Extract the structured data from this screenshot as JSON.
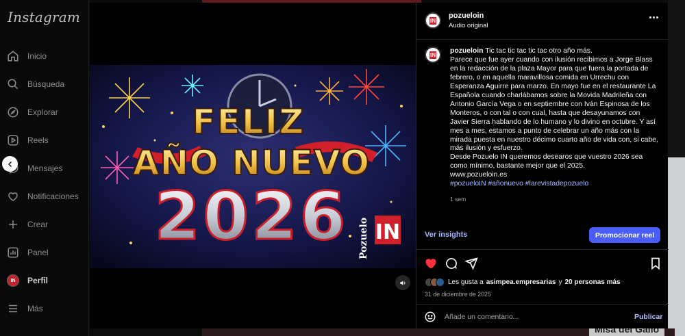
{
  "app": {
    "logo_text": "Instagram"
  },
  "sidebar": {
    "items": [
      {
        "label": "Inicio",
        "icon": "home-icon"
      },
      {
        "label": "Búsqueda",
        "icon": "search-icon"
      },
      {
        "label": "Explorar",
        "icon": "compass-icon"
      },
      {
        "label": "Reels",
        "icon": "reels-icon"
      },
      {
        "label": "Mensajes",
        "icon": "messenger-icon"
      },
      {
        "label": "Notificaciones",
        "icon": "heart-icon"
      },
      {
        "label": "Crear",
        "icon": "plus-icon"
      },
      {
        "label": "Panel",
        "icon": "dashboard-icon"
      },
      {
        "label": "Perfil",
        "icon": "avatar"
      },
      {
        "label": "Más",
        "icon": "menu-icon"
      }
    ]
  },
  "post": {
    "username": "pozueloin",
    "audio": "Audio original",
    "avatar_text": "IN",
    "image": {
      "line1": "FELIZ",
      "line2": "AÑO NUEVO",
      "line3": "2026",
      "brand_vertical": "Pozuelo",
      "brand_badge": "IN"
    },
    "caption": {
      "username": "pozueloin",
      "lines": [
        "Tic tac tic tac tic tac otro año más.",
        "Parece que fue ayer cuando con ilusión recibimos a Jorge Blass en la redacción de la plaza Mayor para que fuera la portada de febrero, o en aquella maravillosa comida en Urrechu con Esperanza Aguirre para marzo. En mayo fue en el restaurante La Española cuando charlábamos sobre la Movida Madrileña con Antonio García Vega o en septiembre con Iván Espinosa de los Monteros, o con tal o con cual, hasta que desayunamos con Javier Sierra hablando de lo humano y lo divino en octubre. Y así mes a mes, estamos a punto de celebrar un año más con la mirada puesta en nuestro décimo cuarto año de vida con, si cabe, más ilusión y esfuerzo.",
        "Desde Pozuelo IN queremos desearos que vuestro 2026 sea como mínimo, bastante mejor que el 2025.",
        "www.pozueloin.es"
      ],
      "hashtags": "#pozueloIN #añonuevo #larevistadepozuelo",
      "time_ago": "1 sem"
    },
    "insights_label": "Ver insights",
    "promote_label": "Promocionar reel",
    "likes": {
      "prefix": "Les gusta a",
      "user": "asimpea.empresarias",
      "connector": "y",
      "others": "20 personas más"
    },
    "date": "31 de diciembre de 2025",
    "comment": {
      "placeholder": "Añade un comentario...",
      "publish_label": "Publicar"
    }
  },
  "background": {
    "bottom_right_text": "Misa del Gallo"
  },
  "colors": {
    "accent": "#4a5df9",
    "like": "#ff3040",
    "link": "#a5b8ff",
    "brand_red": "#d0202c"
  }
}
